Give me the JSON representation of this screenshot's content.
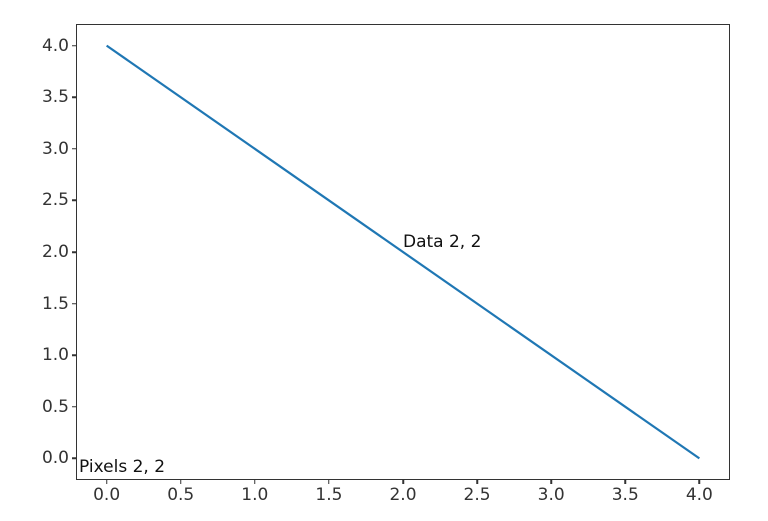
{
  "chart_data": {
    "type": "line",
    "x": [
      0,
      4
    ],
    "y": [
      4,
      0
    ],
    "xlim": [
      -0.2,
      4.2
    ],
    "ylim": [
      -0.2,
      4.2
    ],
    "xticks": [
      0.0,
      0.5,
      1.0,
      1.5,
      2.0,
      2.5,
      3.0,
      3.5,
      4.0
    ],
    "yticks": [
      0.0,
      0.5,
      1.0,
      1.5,
      2.0,
      2.5,
      3.0,
      3.5,
      4.0
    ],
    "xtick_labels": [
      "0.0",
      "0.5",
      "1.0",
      "1.5",
      "2.0",
      "2.5",
      "3.0",
      "3.5",
      "4.0"
    ],
    "ytick_labels": [
      "0.0",
      "0.5",
      "1.0",
      "1.5",
      "2.0",
      "2.5",
      "3.0",
      "3.5",
      "4.0"
    ],
    "line_color": "#1f77b4",
    "title": "",
    "xlabel": "",
    "ylabel": "",
    "annotations": [
      {
        "text": "Data 2, 2",
        "kind": "data",
        "x": 2,
        "y": 2
      },
      {
        "text": "Pixels 2, 2",
        "kind": "pixels",
        "px": 2,
        "py": 2
      }
    ]
  }
}
